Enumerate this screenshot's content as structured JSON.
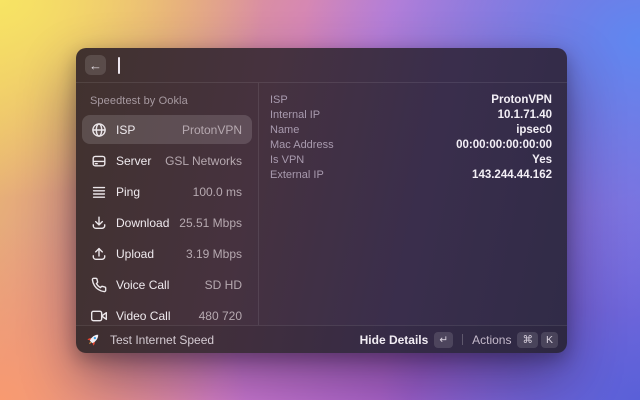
{
  "topbar": {
    "back_glyph": "←",
    "search_value": "",
    "search_placeholder": ""
  },
  "sidebar": {
    "header": "Speedtest by Ookla",
    "items": [
      {
        "icon": "globe-icon",
        "label": "ISP",
        "value": "ProtonVPN",
        "selected": true
      },
      {
        "icon": "server-icon",
        "label": "Server",
        "value": "GSL Networks",
        "selected": false
      },
      {
        "icon": "ping-icon",
        "label": "Ping",
        "value": "100.0 ms",
        "selected": false
      },
      {
        "icon": "download-icon",
        "label": "Download",
        "value": "25.51 Mbps",
        "selected": false
      },
      {
        "icon": "upload-icon",
        "label": "Upload",
        "value": "3.19 Mbps",
        "selected": false
      },
      {
        "icon": "voice-call-icon",
        "label": "Voice Call",
        "value": "SD HD",
        "selected": false
      },
      {
        "icon": "video-call-icon",
        "label": "Video Call",
        "value": "480 720",
        "selected": false
      }
    ]
  },
  "details": {
    "rows": [
      {
        "label": "ISP",
        "value": "ProtonVPN"
      },
      {
        "label": "Internal IP",
        "value": "10.1.71.40"
      },
      {
        "label": "Name",
        "value": "ipsec0"
      },
      {
        "label": "Mac Address",
        "value": "00:00:00:00:00:00"
      },
      {
        "label": "Is VPN",
        "value": "Yes"
      },
      {
        "label": "External IP",
        "value": "143.244.44.162"
      }
    ]
  },
  "footer": {
    "action_title": "Test Internet Speed",
    "primary_action": "Hide Details",
    "primary_key": "↵",
    "secondary_action": "Actions",
    "cmd_key": "⌘",
    "k_key": "K"
  },
  "colors": {
    "background_yellow": "#f7e464",
    "background_orange": "#f89a70",
    "background_pink": "#cf7bd0",
    "background_blue": "#5f87f0",
    "background_violet": "#5a60d8",
    "window_warm": "#46323f",
    "window_cool": "#302b47",
    "selection": "rgba(255,255,255,0.14)"
  }
}
